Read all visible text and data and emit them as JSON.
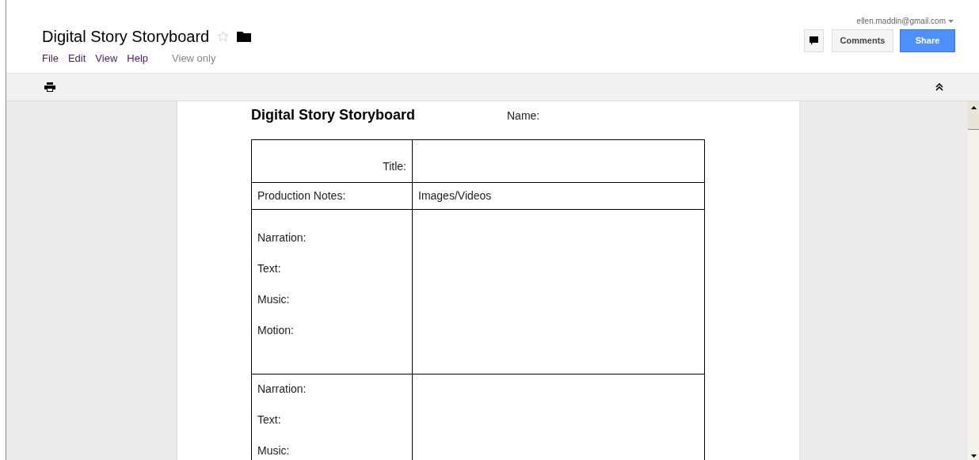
{
  "header": {
    "title": "Digital Story Storyboard",
    "starred": false,
    "menu": [
      "File",
      "Edit",
      "View",
      "Help"
    ],
    "mode": "View only",
    "account": "ellen.maddin@gmail.com",
    "buttons": {
      "comments": "Comments",
      "share": "Share"
    }
  },
  "document": {
    "heading": "Digital Story Storyboard",
    "name_label": "Name:",
    "title_label": "Title:",
    "columns": [
      "Production Notes:",
      "Images/Videos"
    ],
    "scenes": [
      {
        "labels": [
          "Narration:",
          "Text:",
          "Music:",
          "Motion:"
        ]
      },
      {
        "labels": [
          "Narration:",
          "Text:",
          "Music:"
        ]
      }
    ]
  }
}
